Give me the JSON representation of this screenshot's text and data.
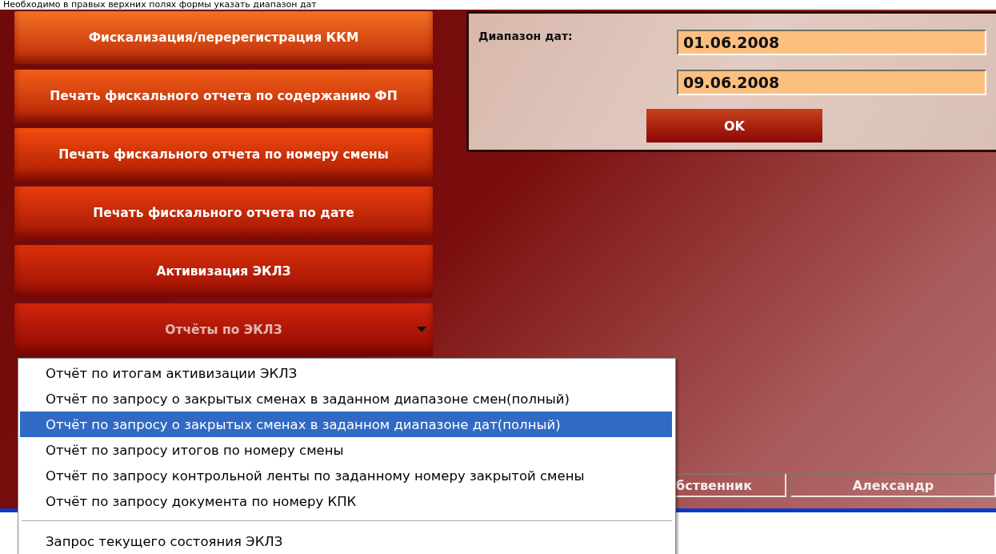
{
  "caption": "Необходимо в правых верхних полях формы указать диапазон дат",
  "menu_buttons": [
    {
      "label": "Фискализация/перерегистрация ККМ",
      "kind": "button"
    },
    {
      "label": "Печать фискального отчета по содержанию ФП",
      "kind": "button"
    },
    {
      "label": "Печать фискального отчета по номеру смены",
      "kind": "button"
    },
    {
      "label": "Печать фискального отчета по дате",
      "kind": "button"
    },
    {
      "label": "Активизация ЭКЛЗ",
      "kind": "button"
    },
    {
      "label": "Отчёты по ЭКЛЗ",
      "kind": "dropdown",
      "expanded": true
    }
  ],
  "date_range": {
    "label": "Диапазон дат:",
    "from": "01.06.2008",
    "to": "09.06.2008",
    "ok_button": "OK"
  },
  "dropdown_items": [
    {
      "label": "Отчёт по итогам активизации ЭКЛЗ",
      "selected": false
    },
    {
      "label": "Отчёт по запросу о закрытых сменах в заданном диапазоне смен(полный)",
      "selected": false
    },
    {
      "label": "Отчёт по запросу о закрытых сменах в заданном диапазоне дат(полный)",
      "selected": true
    },
    {
      "label": "Отчёт по запросу итогов по номеру смены",
      "selected": false
    },
    {
      "label": "Отчёт по запросу контрольной ленты по заданному номеру закрытой смены",
      "selected": false
    },
    {
      "label": "Отчёт по запросу документа по номеру КПК",
      "selected": false
    },
    {
      "label": "Запрос текущего состояния ЭКЛЗ",
      "selected": false,
      "separator_before": true
    }
  ],
  "status_bar": [
    "бственник",
    "Александр"
  ]
}
